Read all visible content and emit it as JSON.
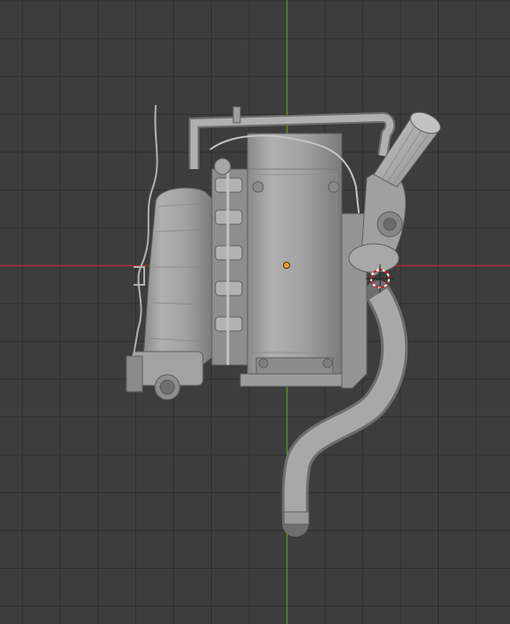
{
  "viewport": {
    "background_color": "#3d3d3d",
    "grid_color": "#2f2f2f",
    "x_axis_color": "#a8323a",
    "y_axis_color": "#5b8a2a",
    "model_color": "#9a9a9a",
    "origin_color": "#f0a030",
    "cursor_colors": [
      "#cc2222",
      "#ffffff"
    ]
  },
  "scene": {
    "object": "engine-model",
    "view": "top-orthographic"
  }
}
